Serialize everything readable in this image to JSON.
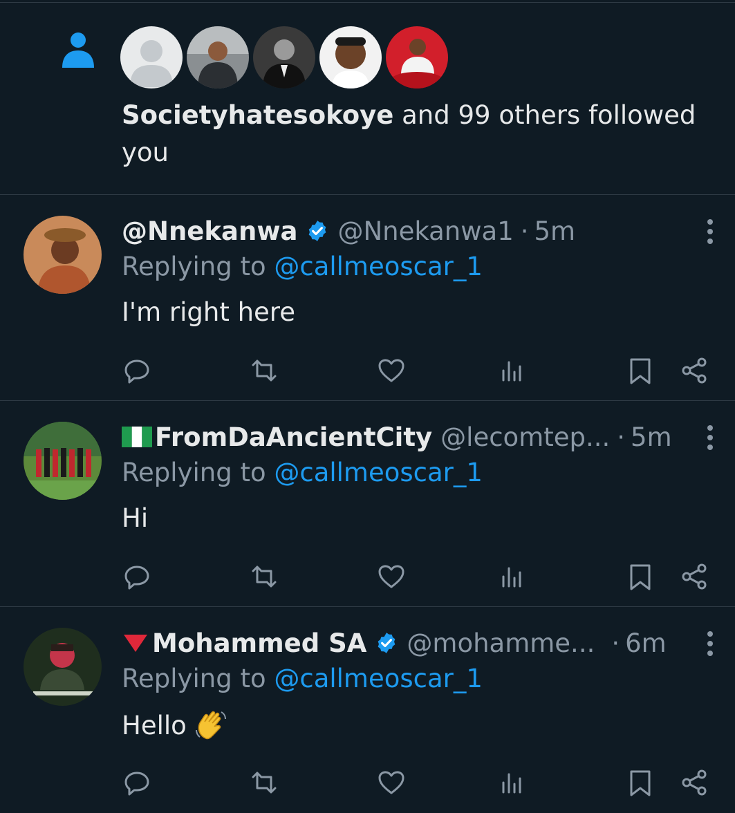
{
  "follow_notification": {
    "name": "Societyhatesokoye",
    "text": " and 99 others followed you",
    "avatars": [
      "default-avatar",
      "follower-avatar-2",
      "follower-avatar-3",
      "follower-avatar-4",
      "follower-avatar-5"
    ]
  },
  "tweets": [
    {
      "display_name": "@Nnekanwa",
      "verified": true,
      "handle": "@Nnekanwa1",
      "time": "5m",
      "replying_prefix": "Replying to ",
      "replying_to": "@callmeoscar_1",
      "body": "I'm right here"
    },
    {
      "display_name": "FromDaAncientCity",
      "flag": "nigeria-flag",
      "verified": false,
      "handle": "@lecomtep...",
      "time": "5m",
      "replying_prefix": "Replying to ",
      "replying_to": "@callmeoscar_1",
      "body": "Hi"
    },
    {
      "display_name": "Mohammed SA",
      "flag": "red-triangle",
      "verified": true,
      "handle": "@mohamme...",
      "time": "6m",
      "replying_prefix": "Replying to ",
      "replying_to": "@callmeoscar_1",
      "body": "Hello",
      "emoji": "waving-hand"
    }
  ],
  "separator": "·",
  "colors": {
    "background": "#0f1b24",
    "accent": "#1d9bf0",
    "muted": "#8b98a5",
    "divider": "#2f3b45"
  }
}
